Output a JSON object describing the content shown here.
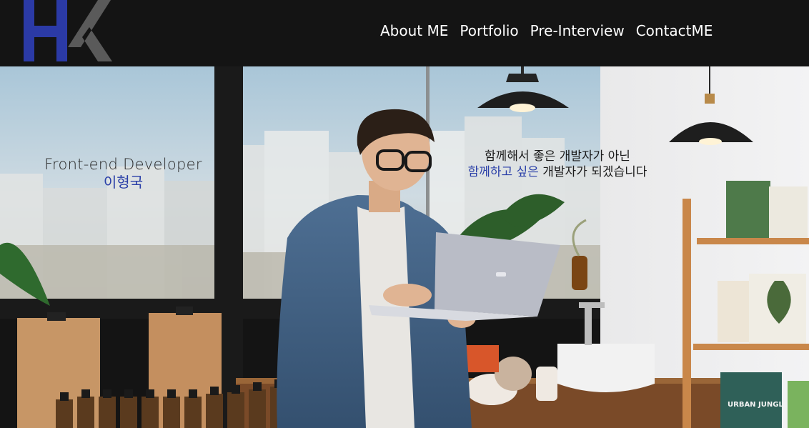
{
  "logo": {
    "text": "HK",
    "colors": {
      "h": "#2b3aa6",
      "k": "#585858"
    }
  },
  "nav": {
    "items": [
      {
        "label": "About ME"
      },
      {
        "label": "Portfolio"
      },
      {
        "label": "Pre-Interview"
      },
      {
        "label": "ContactME"
      }
    ]
  },
  "hero": {
    "role": "Front-end Developer",
    "name": "이형국",
    "slogan_line1": "함께해서 좋은 개발자가 아닌",
    "slogan_line2_highlight": "함께하고 싶은",
    "slogan_line2_rest": " 개발자가 되겠습니다",
    "book_label": "URBAN JUNGLE"
  },
  "colors": {
    "header_bg": "#141414",
    "accent": "#2a3fa8",
    "nav_text": "#ffffff"
  }
}
